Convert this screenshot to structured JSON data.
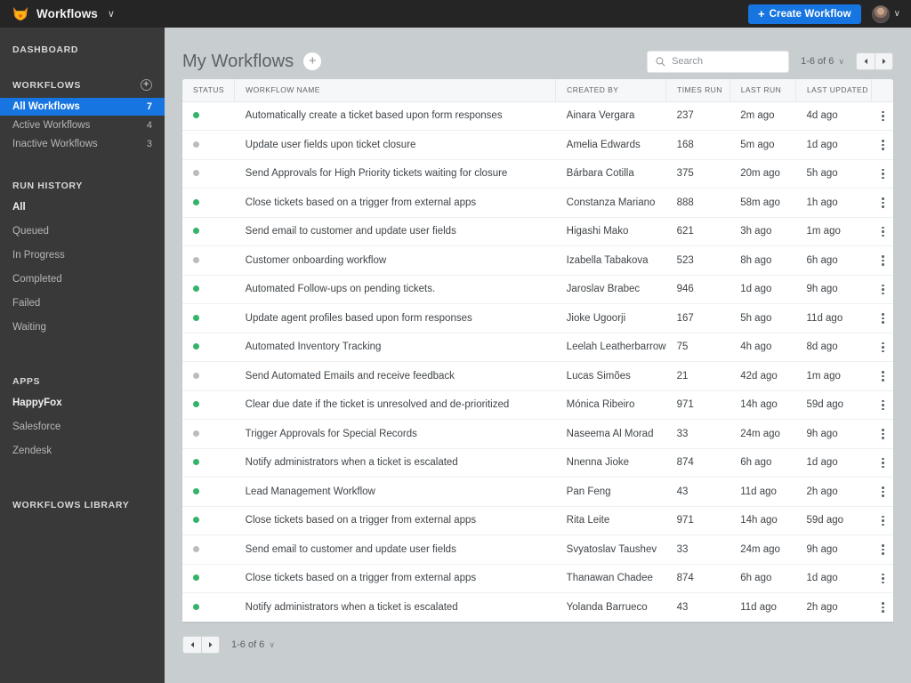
{
  "topbar": {
    "logo_icon": "fox-logo-icon",
    "brand_title": "Workflows",
    "brand_caret": "∨",
    "create_button": {
      "plus": "+",
      "label": "Create Workflow"
    },
    "avatar_caret": "∨"
  },
  "sidebar": {
    "dashboard_label": "DASHBOARD",
    "workflows_section": {
      "label": "WORKFLOWS",
      "add_icon": "+"
    },
    "workflow_items": [
      {
        "label": "All Workflows",
        "count": "7",
        "active": true
      },
      {
        "label": "Active Workflows",
        "count": "4",
        "active": false
      },
      {
        "label": "Inactive Workflows",
        "count": "3",
        "active": false
      }
    ],
    "run_history_label": "RUN HISTORY",
    "run_history_items": [
      {
        "label": "All",
        "selected": true
      },
      {
        "label": "Queued",
        "selected": false
      },
      {
        "label": "In Progress",
        "selected": false
      },
      {
        "label": "Completed",
        "selected": false
      },
      {
        "label": "Failed",
        "selected": false
      },
      {
        "label": "Waiting",
        "selected": false
      }
    ],
    "apps_label": "APPS",
    "apps_items": [
      {
        "label": "HappyFox",
        "selected": true
      },
      {
        "label": "Salesforce",
        "selected": false
      },
      {
        "label": "Zendesk",
        "selected": false
      }
    ],
    "library_label": "WORKFLOWS LIBRARY"
  },
  "main": {
    "page_title": "My Workflows",
    "title_add_icon": "+",
    "search": {
      "icon": "search-icon",
      "placeholder": "Search",
      "value": ""
    },
    "pagination": {
      "range": "1-6 of 6",
      "chevron": "∨",
      "prev_icon": "◀",
      "next_icon": "▶"
    }
  },
  "table": {
    "columns": [
      "STATUS",
      "WORKFLOW NAME",
      "CREATED BY",
      "TIMES RUN",
      "LAST RUN",
      "LAST UPDATED"
    ],
    "rows": [
      {
        "status": "active",
        "name": "Automatically create a ticket based upon form responses",
        "created_by": "Ainara Vergara",
        "times_run": "237",
        "last_run": "2m ago",
        "last_updated": "4d ago"
      },
      {
        "status": "inactive",
        "name": "Update user fields upon ticket closure",
        "created_by": "Amelia Edwards",
        "times_run": "168",
        "last_run": "5m ago",
        "last_updated": "1d ago"
      },
      {
        "status": "inactive",
        "name": "Send Approvals for High Priority tickets waiting for closure",
        "created_by": "Bárbara Cotilla",
        "times_run": "375",
        "last_run": "20m ago",
        "last_updated": "5h ago"
      },
      {
        "status": "active",
        "name": "Close tickets based on a trigger from external apps",
        "created_by": "Constanza Mariano",
        "times_run": "888",
        "last_run": "58m ago",
        "last_updated": "1h ago"
      },
      {
        "status": "active",
        "name": "Send email to customer and update user fields",
        "created_by": "Higashi Mako",
        "times_run": "621",
        "last_run": "3h ago",
        "last_updated": "1m ago"
      },
      {
        "status": "inactive",
        "name": "Customer onboarding workflow",
        "created_by": "Izabella Tabakova",
        "times_run": "523",
        "last_run": "8h ago",
        "last_updated": "6h ago"
      },
      {
        "status": "active",
        "name": "Automated Follow-ups on pending tickets.",
        "created_by": "Jaroslav Brabec",
        "times_run": "946",
        "last_run": "1d ago",
        "last_updated": "9h ago"
      },
      {
        "status": "active",
        "name": "Update agent profiles based upon form responses",
        "created_by": "Jioke Ugoorji",
        "times_run": "167",
        "last_run": "5h ago",
        "last_updated": "11d ago"
      },
      {
        "status": "active",
        "name": "Automated Inventory Tracking",
        "created_by": "Leelah Leatherbarrow",
        "times_run": "75",
        "last_run": "4h ago",
        "last_updated": "8d ago"
      },
      {
        "status": "inactive",
        "name": "Send Automated Emails and receive feedback",
        "created_by": "Lucas Simões",
        "times_run": "21",
        "last_run": "42d ago",
        "last_updated": "1m ago"
      },
      {
        "status": "active",
        "name": "Clear due date if the ticket is unresolved and de-prioritized",
        "created_by": "Mónica Ribeiro",
        "times_run": "971",
        "last_run": "14h ago",
        "last_updated": "59d ago"
      },
      {
        "status": "inactive",
        "name": "Trigger Approvals for Special Records",
        "created_by": "Naseema Al Morad",
        "times_run": "33",
        "last_run": "24m ago",
        "last_updated": "9h ago"
      },
      {
        "status": "active",
        "name": "Notify administrators when a ticket is escalated",
        "created_by": "Nnenna Jioke",
        "times_run": "874",
        "last_run": "6h ago",
        "last_updated": "1d ago"
      },
      {
        "status": "active",
        "name": "Lead Management Workflow",
        "created_by": "Pan Feng",
        "times_run": "43",
        "last_run": "11d ago",
        "last_updated": "2h ago"
      },
      {
        "status": "active",
        "name": "Close tickets based on a trigger from external apps",
        "created_by": "Rita Leite",
        "times_run": "971",
        "last_run": "14h ago",
        "last_updated": "59d ago"
      },
      {
        "status": "inactive",
        "name": "Send email to customer and update user fields",
        "created_by": "Svyatoslav Taushev",
        "times_run": "33",
        "last_run": "24m ago",
        "last_updated": "9h ago"
      },
      {
        "status": "active",
        "name": "Close tickets based on a trigger from external apps",
        "created_by": "Thanawan Chadee",
        "times_run": "874",
        "last_run": "6h ago",
        "last_updated": "1d ago"
      },
      {
        "status": "active",
        "name": "Notify administrators when a ticket is escalated",
        "created_by": "Yolanda Barrueco",
        "times_run": "43",
        "last_run": "11d ago",
        "last_updated": "2h ago"
      }
    ]
  },
  "bottom_pagination": {
    "prev_icon": "◀",
    "next_icon": "▶",
    "range": "1-6 of 6",
    "chevron": "∨"
  },
  "colors": {
    "accent_blue": "#1675e0",
    "status_active": "#34b36a",
    "status_inactive": "#b9bdc0",
    "sidebar_bg": "#393939",
    "topbar_bg": "#252525",
    "page_bg": "#c8cdd0",
    "logo_orange": "#f58220"
  }
}
